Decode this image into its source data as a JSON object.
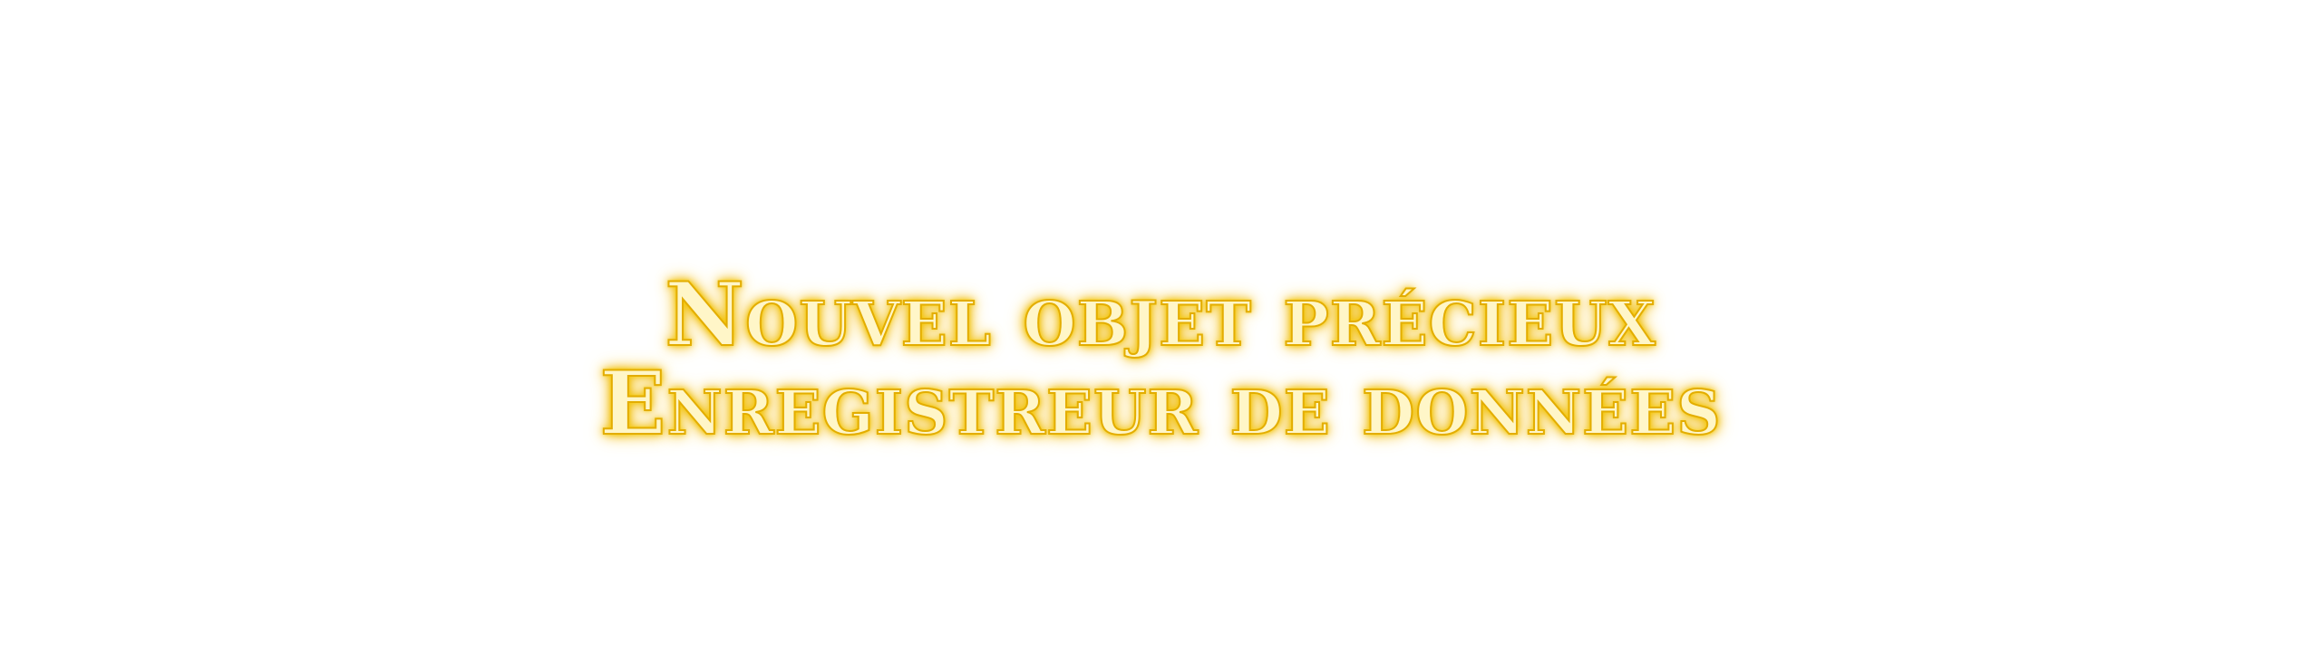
{
  "notification": {
    "title": "Nouvel objet précieux",
    "item_name": "Enregistreur de données"
  },
  "colors": {
    "background": "#ffffff",
    "text_fill": "#fff6c8",
    "text_outline": "#e3ad00",
    "glow": "#ffd700"
  }
}
